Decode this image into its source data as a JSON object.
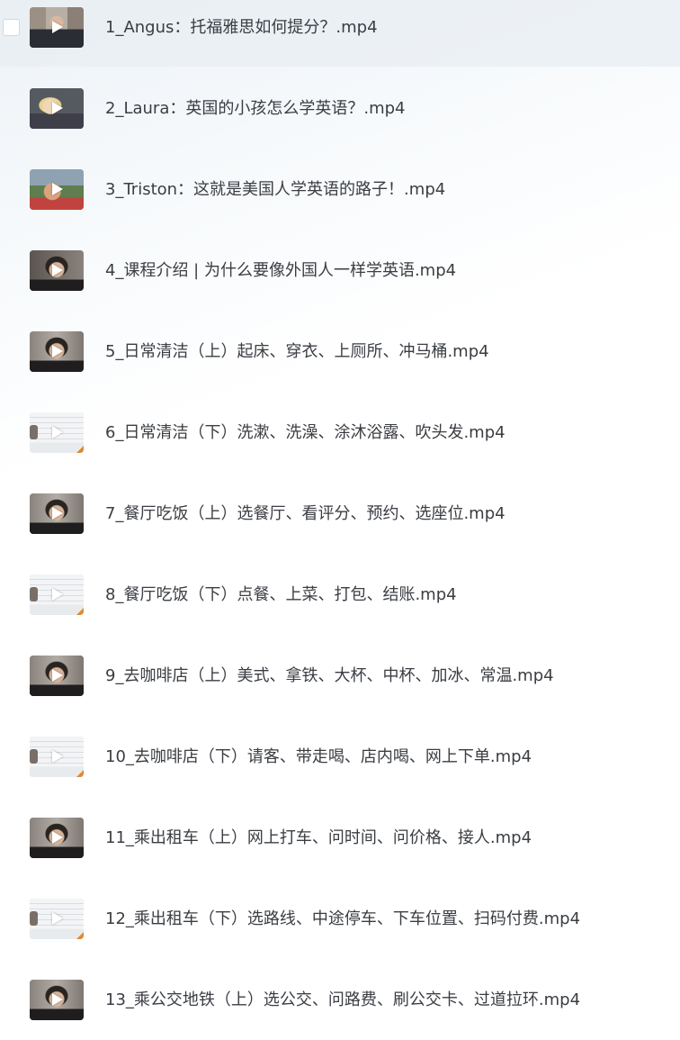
{
  "files": [
    {
      "name": "1_Angus：托福雅思如何提分？.mp4",
      "thumbnail": "office-interview",
      "selected": true
    },
    {
      "name": "2_Laura：英国的小孩怎么学英语？.mp4",
      "thumbnail": "woman-speaking",
      "selected": false
    },
    {
      "name": "3_Triston：这就是美国人学英语的路子！.mp4",
      "thumbnail": "man-outdoors",
      "selected": false
    },
    {
      "name": "4_课程介绍 | 为什么要像外国人一样学英语.mp4",
      "thumbnail": "presenter",
      "selected": false
    },
    {
      "name": "5_日常清洁（上）起床、穿衣、上厕所、冲马桶.mp4",
      "thumbnail": "presenter",
      "selected": false
    },
    {
      "name": "6_日常清洁（下）洗漱、洗澡、涂沐浴露、吹头发.mp4",
      "thumbnail": "slide",
      "selected": false
    },
    {
      "name": "7_餐厅吃饭（上）选餐厅、看评分、预约、选座位.mp4",
      "thumbnail": "presenter",
      "selected": false
    },
    {
      "name": "8_餐厅吃饭（下）点餐、上菜、打包、结账.mp4",
      "thumbnail": "slide",
      "selected": false
    },
    {
      "name": "9_去咖啡店（上）美式、拿铁、大杯、中杯、加冰、常温.mp4",
      "thumbnail": "presenter",
      "selected": false
    },
    {
      "name": "10_去咖啡店（下）请客、带走喝、店内喝、网上下单.mp4",
      "thumbnail": "slide",
      "selected": false
    },
    {
      "name": "11_乘出租车（上）网上打车、问时间、问价格、接人.mp4",
      "thumbnail": "presenter",
      "selected": false
    },
    {
      "name": "12_乘出租车（下）选路线、中途停车、下车位置、扫码付费.mp4",
      "thumbnail": "slide",
      "selected": false
    },
    {
      "name": "13_乘公交地铁（上）选公交、问路费、刷公交卡、过道拉环.mp4",
      "thumbnail": "presenter",
      "selected": false
    }
  ],
  "icons": {
    "play": "play-icon",
    "checkbox": "checkbox-icon"
  },
  "colors": {
    "text": "#3a3d42",
    "selected_row_bg": "#e8edf3",
    "play_icon": "#ffffff"
  }
}
